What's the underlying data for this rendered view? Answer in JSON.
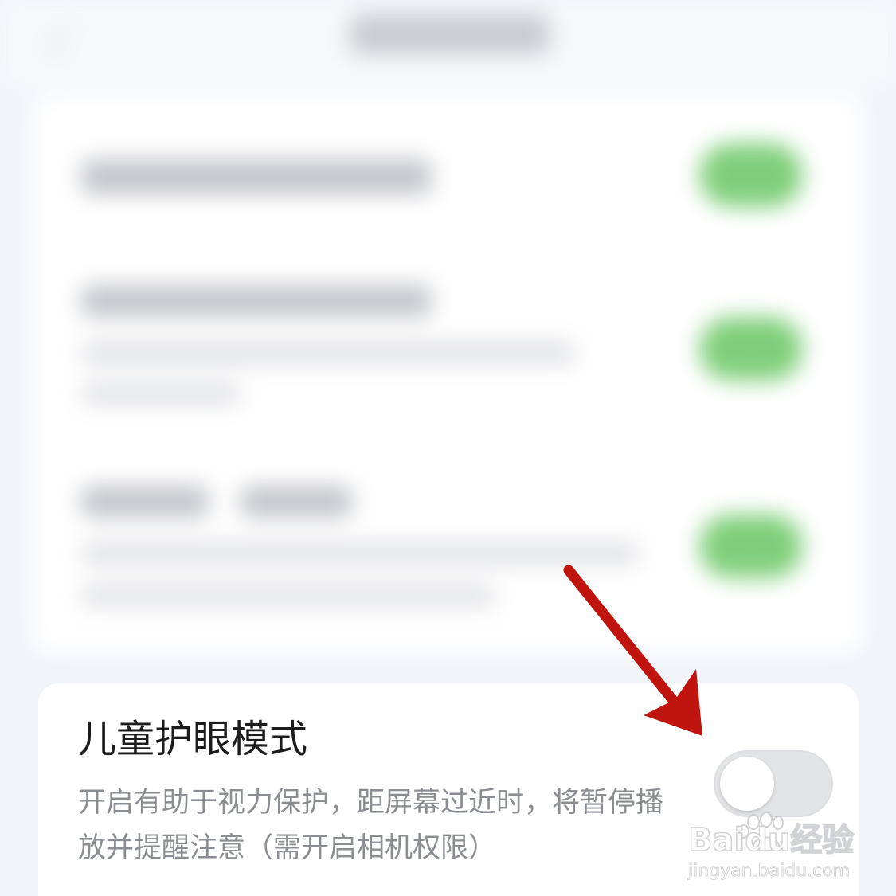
{
  "setting": {
    "title": "儿童护眼模式",
    "description": "开启有助于视力保护，距屏幕过近时，将暂停播放并提醒注意（需开启相机权限）",
    "toggle_state": "off"
  },
  "watermark": {
    "brand_text": "Baidu经验",
    "url_text": "jingyan.baidu.com"
  },
  "colors": {
    "toggle_on": "#7fcf7a",
    "toggle_off": "#e3e4e6",
    "arrow": "#c0140f",
    "title_text": "#1c1c1c",
    "desc_text": "#8a8d92"
  }
}
